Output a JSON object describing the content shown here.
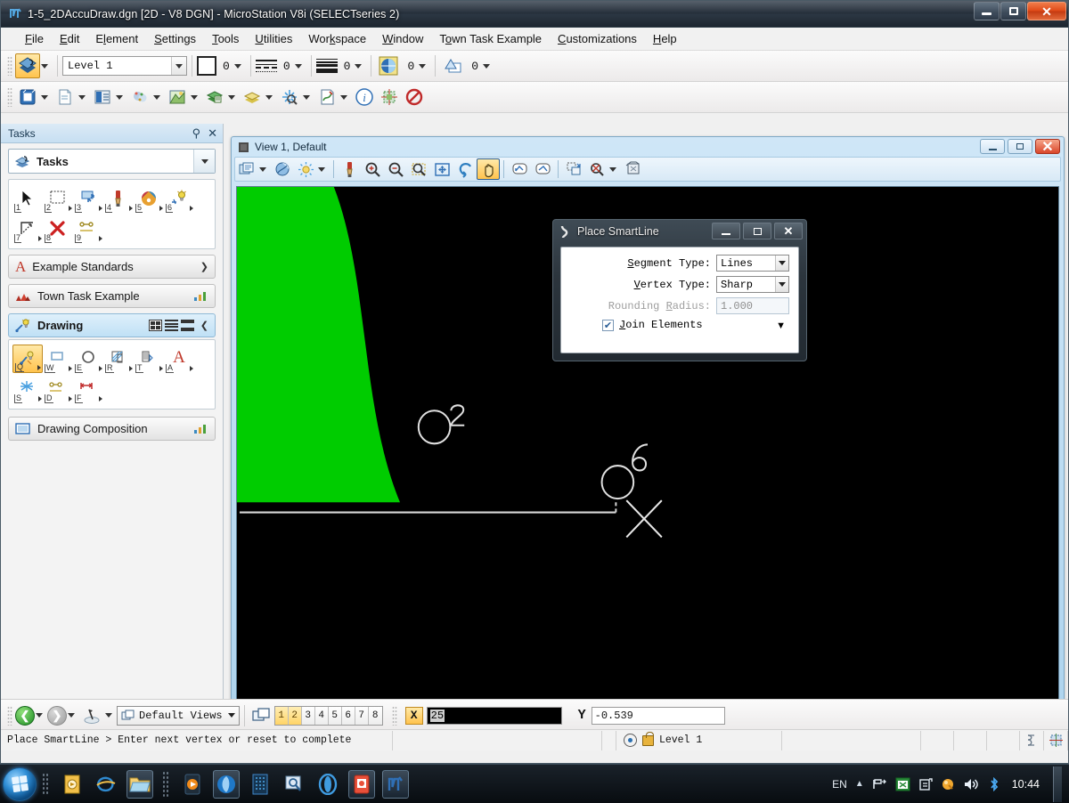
{
  "window": {
    "title": "1-5_2DAccuDraw.dgn [2D - V8 DGN] - MicroStation V8i (SELECTseries 2)",
    "icon": "microstation-icon",
    "minimize_label": "Minimize",
    "maximize_label": "Maximize",
    "close_label": "Close"
  },
  "menubar": {
    "items": [
      {
        "label": "File",
        "accel": "F"
      },
      {
        "label": "Edit",
        "accel": "E"
      },
      {
        "label": "Element",
        "accel": "l"
      },
      {
        "label": "Settings",
        "accel": "S"
      },
      {
        "label": "Tools",
        "accel": "T"
      },
      {
        "label": "Utilities",
        "accel": "U"
      },
      {
        "label": "Workspace",
        "accel": "k"
      },
      {
        "label": "Window",
        "accel": "W"
      },
      {
        "label": "Town Task Example",
        "accel": "o"
      },
      {
        "label": "Customizations",
        "accel": "C"
      },
      {
        "label": "Help",
        "accel": "H"
      }
    ]
  },
  "attributes_toolbar": {
    "active_level_icon": "active-level-icon",
    "level": "Level 1",
    "color_value": "0",
    "linestyle_value": "0",
    "lineweight_value": "0",
    "transparency_value": "0",
    "priority_value": "0"
  },
  "primary_toolbar": {
    "items": [
      {
        "name": "models-icon"
      },
      {
        "name": "references-icon"
      },
      {
        "name": "raster-manager-icon"
      },
      {
        "name": "point-cloud-icon"
      },
      {
        "name": "level-manager-icon"
      },
      {
        "name": "level-display-icon"
      },
      {
        "name": "element-selection-icon"
      },
      {
        "name": "analyze-element-icon"
      },
      {
        "name": "element-info-icon"
      },
      {
        "name": "fence-icon"
      },
      {
        "name": "no-element-icon"
      }
    ]
  },
  "tasks_panel": {
    "title": "Tasks",
    "pin_icon": "pin-icon",
    "close_icon": "close-icon",
    "selector": {
      "label": "Tasks",
      "icon": "tasks-icon"
    },
    "main_tools": [
      {
        "num": "1",
        "name": "element-selection-tool"
      },
      {
        "num": "2",
        "name": "fence-tool"
      },
      {
        "num": "3",
        "name": "place-smartline-tool"
      },
      {
        "num": "4",
        "name": "manipulate-tool"
      },
      {
        "num": "5",
        "name": "change-attributes-tool"
      },
      {
        "num": "6",
        "name": "modify-tool"
      },
      {
        "num": "7",
        "name": "measure-tool"
      },
      {
        "num": "8",
        "name": "delete-element-tool"
      },
      {
        "num": "9",
        "name": "dimension-tool"
      }
    ],
    "groups": [
      {
        "label": "Example Standards",
        "icon": "letter-a-icon",
        "right_icon": "chevron-down-icon",
        "highlighted": false
      },
      {
        "label": "Town Task Example",
        "icon": "town-icon",
        "right_icon": "chart-icon",
        "highlighted": false
      },
      {
        "label": "Drawing",
        "icon": "drawing-icon",
        "right_icon": "chevron-up-icon",
        "highlighted": true
      },
      {
        "label": "Drawing Composition",
        "icon": "composition-icon",
        "right_icon": "chart-icon",
        "highlighted": false
      }
    ],
    "drawing_tools": [
      {
        "key": "Q",
        "name": "place-smartline-tool",
        "selected": true
      },
      {
        "key": "W",
        "name": "place-block-tool",
        "selected": false
      },
      {
        "key": "E",
        "name": "place-circle-tool",
        "selected": false
      },
      {
        "key": "R",
        "name": "pattern-area-tool",
        "selected": false
      },
      {
        "key": "T",
        "name": "place-text-tool",
        "selected": false
      },
      {
        "key": "A",
        "name": "text-tool",
        "selected": false
      },
      {
        "key": "S",
        "name": "modify-element-tool",
        "selected": false
      },
      {
        "key": "D",
        "name": "dimension-element-tool",
        "selected": false
      },
      {
        "key": "F",
        "name": "dimension-linear-tool",
        "selected": false
      }
    ]
  },
  "view_window": {
    "title": "View 1, Default",
    "window_icon": "view-icon",
    "minimize_label": "Minimize",
    "maximize_label": "Maximize",
    "close_label": "Close",
    "toolbar": [
      {
        "name": "view-attributes-icon",
        "has_caret": true
      },
      {
        "name": "view-display-mode-icon",
        "has_caret": false
      },
      {
        "name": "view-brightness-icon",
        "has_caret": true
      },
      {
        "name": "update-view-icon",
        "has_caret": false
      },
      {
        "name": "zoom-in-icon",
        "has_caret": false
      },
      {
        "name": "zoom-out-icon",
        "has_caret": false
      },
      {
        "name": "window-area-icon",
        "has_caret": false
      },
      {
        "name": "fit-view-icon",
        "has_caret": false
      },
      {
        "name": "rotate-view-icon",
        "has_caret": false
      },
      {
        "name": "pan-view-icon",
        "has_caret": false,
        "active": true
      },
      {
        "name": "view-previous-icon",
        "has_caret": false
      },
      {
        "name": "view-next-icon",
        "has_caret": false
      },
      {
        "name": "copy-view-icon",
        "has_caret": false
      },
      {
        "name": "clip-volume-icon",
        "has_caret": true
      },
      {
        "name": "clip-mask-icon",
        "has_caret": false
      }
    ]
  },
  "canvas": {
    "background_color": "#000000",
    "shape_color": "#00cc00",
    "line_color": "#dcdcdc",
    "elements": [
      {
        "name": "green-arc-region",
        "type": "filled-arc"
      },
      {
        "name": "circle-label-2",
        "type": "circle",
        "label": "2"
      },
      {
        "name": "circle-label-6",
        "type": "circle",
        "label": "6"
      },
      {
        "name": "smartline-segment",
        "type": "polyline"
      },
      {
        "name": "cursor-cross",
        "type": "cursor"
      }
    ]
  },
  "smartline_dialog": {
    "title": "Place SmartLine",
    "icon": "smartline-icon",
    "minimize_label": "Minimize",
    "maximize_label": "Maximize",
    "close_label": "Close",
    "fields": [
      {
        "label": "Segment Type:",
        "accel": "S",
        "value": "Lines",
        "type": "combo",
        "disabled": false
      },
      {
        "label": "Vertex Type:",
        "accel": "V",
        "value": "Sharp",
        "type": "combo",
        "disabled": false
      },
      {
        "label": "Rounding Radius:",
        "accel": "R",
        "value": "1.000",
        "type": "text",
        "disabled": true
      }
    ],
    "checkbox": {
      "label": "Join Elements",
      "accel": "J",
      "checked": true
    },
    "expand_icon": "chevron-down-icon"
  },
  "navigation_bar": {
    "back_icon": "back-arrow-icon",
    "forward_icon": "forward-arrow-icon",
    "rotate_icon": "rotate-icon",
    "view_group": "Default Views",
    "view_group_icon": "views-icon",
    "window_icon": "cascade-windows-icon",
    "view_numbers": [
      "1",
      "2",
      "3",
      "4",
      "5",
      "6",
      "7",
      "8"
    ],
    "active_views": [
      "1",
      "2"
    ],
    "x_label": "X",
    "x_value": "25",
    "y_label": "Y",
    "y_value": "-0.539"
  },
  "statusbar": {
    "message": "Place SmartLine > Enter next vertex or reset to complete",
    "snap_icon": "snap-mode-icon",
    "lock_icon": "lock-icon",
    "level": "Level 1",
    "right_icons": [
      "element-icon",
      "fence-icon"
    ]
  },
  "taskbar": {
    "start_label": "Start",
    "apps": [
      {
        "name": "media-center-icon",
        "framed": false
      },
      {
        "name": "internet-explorer-icon",
        "framed": false
      },
      {
        "name": "windows-explorer-icon",
        "framed": true
      },
      {
        "name": "media-player-icon",
        "framed": false
      },
      {
        "name": "browser-icon",
        "framed": true
      },
      {
        "name": "screen-recorder-icon",
        "framed": false
      },
      {
        "name": "search-tool-icon",
        "framed": false
      },
      {
        "name": "opera-icon",
        "framed": false
      },
      {
        "name": "camtasia-icon",
        "framed": true
      },
      {
        "name": "microstation-icon",
        "framed": true
      }
    ],
    "tray": {
      "language": "EN",
      "show_hidden_icon": "chevron-up-icon",
      "network_icon": "network-icon",
      "excel_icon": "excel-icon",
      "safely-remove_icon": "eject-icon",
      "action_center_icon": "flag-icon",
      "volume_icon": "volume-icon",
      "bluetooth_icon": "bluetooth-icon",
      "clock": "10:44"
    }
  }
}
